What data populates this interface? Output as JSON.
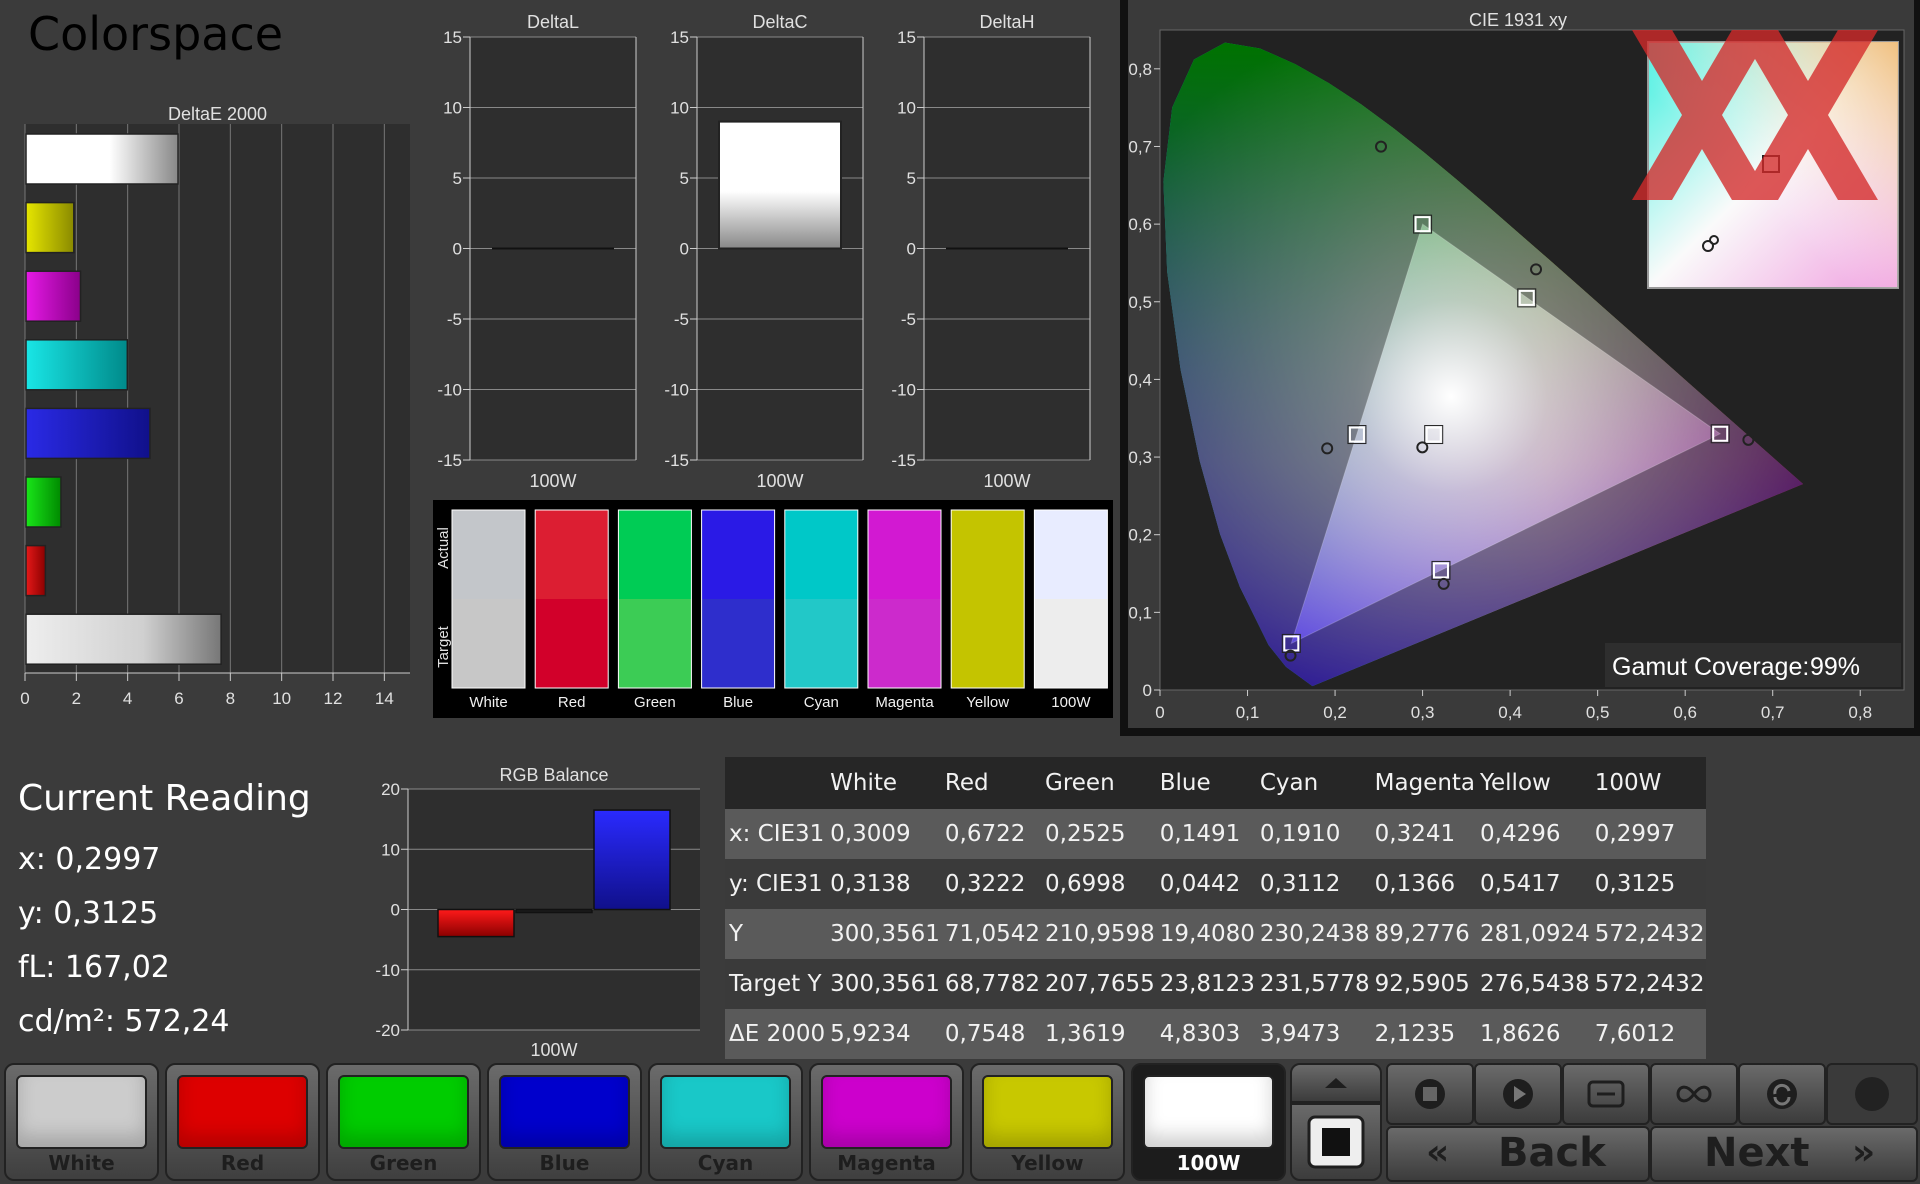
{
  "title": "Colorspace",
  "colors": {
    "white": "#e8e8e8",
    "red": "#d9001a",
    "green": "#00cc33",
    "blue": "#1a1acc",
    "cyan": "#19c7c7",
    "magenta": "#cc19cc",
    "yellow": "#c7c700",
    "w100": "#ffffff"
  },
  "chart_data": [
    {
      "id": "deltae",
      "type": "bar",
      "orientation": "horizontal",
      "title": "DeltaE 2000",
      "categories": [
        "White",
        "Red",
        "Green",
        "Blue",
        "Cyan",
        "Magenta",
        "Yellow",
        "100W"
      ],
      "values": [
        5.9234,
        0.7548,
        1.3619,
        4.8303,
        3.9473,
        2.1235,
        1.8626,
        7.6012
      ],
      "xlim": [
        0,
        15
      ],
      "xticks": [
        "0",
        "2",
        "4",
        "6",
        "8",
        "10",
        "12",
        "14"
      ]
    },
    {
      "id": "deltal",
      "type": "bar",
      "title": "DeltaL",
      "categories": [
        "100W"
      ],
      "values": [
        0
      ],
      "ylim": [
        -15,
        15
      ],
      "yticks": [
        "15",
        "10",
        "5",
        "0",
        "-5",
        "-10",
        "-15"
      ]
    },
    {
      "id": "deltac",
      "type": "bar",
      "title": "DeltaC",
      "categories": [
        "100W"
      ],
      "values": [
        9
      ],
      "ylim": [
        -15,
        15
      ],
      "yticks": [
        "15",
        "10",
        "5",
        "0",
        "-5",
        "-10",
        "-15"
      ]
    },
    {
      "id": "deltah",
      "type": "bar",
      "title": "DeltaH",
      "categories": [
        "100W"
      ],
      "values": [
        0
      ],
      "ylim": [
        -15,
        15
      ],
      "yticks": [
        "15",
        "10",
        "5",
        "0",
        "-5",
        "-10",
        "-15"
      ]
    },
    {
      "id": "rgb",
      "type": "bar",
      "title": "RGB Balance",
      "categories": [
        "100W"
      ],
      "series": [
        {
          "values": [
            -4.5
          ]
        },
        {
          "values": [
            -0.5
          ]
        },
        {
          "values": [
            16.5
          ]
        }
      ],
      "ylim": [
        -20,
        20
      ],
      "yticks": [
        "20",
        "10",
        "0",
        "-10",
        "-20"
      ]
    },
    {
      "id": "cie",
      "type": "scatter",
      "title": "CIE 1931 xy",
      "xlim": [
        0,
        0.85
      ],
      "ylim": [
        0,
        0.85
      ],
      "xticks": [
        "0",
        "0,1",
        "0,2",
        "0,3",
        "0,4",
        "0,5",
        "0,6",
        "0,7",
        "0,8"
      ],
      "yticks": [
        "0,8",
        "0,7",
        "0,6",
        "0,5",
        "0,4",
        "0,3",
        "0,2",
        "0,1",
        "0"
      ],
      "targets": [
        [
          0.64,
          0.33
        ],
        [
          0.3,
          0.6
        ],
        [
          0.15,
          0.06
        ],
        [
          0.3127,
          0.329
        ],
        [
          0.225,
          0.329
        ],
        [
          0.321,
          0.154
        ],
        [
          0.419,
          0.505
        ]
      ],
      "measured": [
        [
          0.6722,
          0.3222
        ],
        [
          0.2525,
          0.6998
        ],
        [
          0.1491,
          0.0442
        ],
        [
          0.2997,
          0.3125
        ],
        [
          0.191,
          0.3112
        ],
        [
          0.3241,
          0.1366
        ],
        [
          0.4296,
          0.5417
        ]
      ],
      "gamut_coverage_label": "Gamut Coverage:",
      "gamut_coverage_value": "99%"
    }
  ],
  "swatches": {
    "actual_label": "Actual",
    "target_label": "Target",
    "items": [
      {
        "label": "White",
        "actual": "#c3c6ca",
        "target": "#c7c7c7"
      },
      {
        "label": "Red",
        "actual": "#dc1e32",
        "target": "#d2002a"
      },
      {
        "label": "Green",
        "actual": "#00cc55",
        "target": "#3ccc55"
      },
      {
        "label": "Blue",
        "actual": "#2a1ae6",
        "target": "#2e2ecc"
      },
      {
        "label": "Cyan",
        "actual": "#00c8c8",
        "target": "#22c8c8"
      },
      {
        "label": "Magenta",
        "actual": "#d219d2",
        "target": "#cc2acc"
      },
      {
        "label": "Yellow",
        "actual": "#c4c400",
        "target": "#c4c400"
      },
      {
        "label": "100W",
        "actual": "#e8ecff",
        "target": "#ededed"
      }
    ]
  },
  "reading": {
    "title": "Current Reading",
    "x": "x: 0,2997",
    "y": "y: 0,3125",
    "fl": "fL: 167,02",
    "cd": "cd/m²: 572,24"
  },
  "table": {
    "headers": [
      "",
      "White",
      "Red",
      "Green",
      "Blue",
      "Cyan",
      "Magenta",
      "Yellow",
      "100W"
    ],
    "rows": [
      [
        "x: CIE31",
        "0,3009",
        "0,6722",
        "0,2525",
        "0,1491",
        "0,1910",
        "0,3241",
        "0,4296",
        "0,2997"
      ],
      [
        "y: CIE31",
        "0,3138",
        "0,3222",
        "0,6998",
        "0,0442",
        "0,3112",
        "0,1366",
        "0,5417",
        "0,3125"
      ],
      [
        "Y",
        "300,3561",
        "71,0542",
        "210,9598",
        "19,4080",
        "230,2438",
        "89,2776",
        "281,0924",
        "572,2432"
      ],
      [
        "Target Y",
        "300,3561",
        "68,7782",
        "207,7655",
        "23,8123",
        "231,5778",
        "92,5905",
        "276,5438",
        "572,2432"
      ],
      [
        "ΔE 2000",
        "5,9234",
        "0,7548",
        "1,3619",
        "4,8303",
        "3,9473",
        "2,1235",
        "1,8626",
        "7,6012"
      ]
    ]
  },
  "bottom_buttons": [
    {
      "label": "White",
      "color": "#cccccc"
    },
    {
      "label": "Red",
      "color": "#dd0000"
    },
    {
      "label": "Green",
      "color": "#00cc00"
    },
    {
      "label": "Blue",
      "color": "#0000cc"
    },
    {
      "label": "Cyan",
      "color": "#19c8c8"
    },
    {
      "label": "Magenta",
      "color": "#cc00cc"
    },
    {
      "label": "Yellow",
      "color": "#c8c800"
    },
    {
      "label": "100W",
      "color": "#ffffff"
    }
  ],
  "nav": {
    "back": "Back",
    "next": "Next",
    "back_arrows": "«",
    "next_arrows": "»"
  },
  "icons": {
    "up": "up-arrow-icon",
    "stop": "stop-icon",
    "play": "play-icon",
    "measure": "measure-range-icon",
    "loop": "loop-icon",
    "refresh": "refresh-icon",
    "record": "record-stop-icon",
    "dot": "status-dot-icon"
  }
}
